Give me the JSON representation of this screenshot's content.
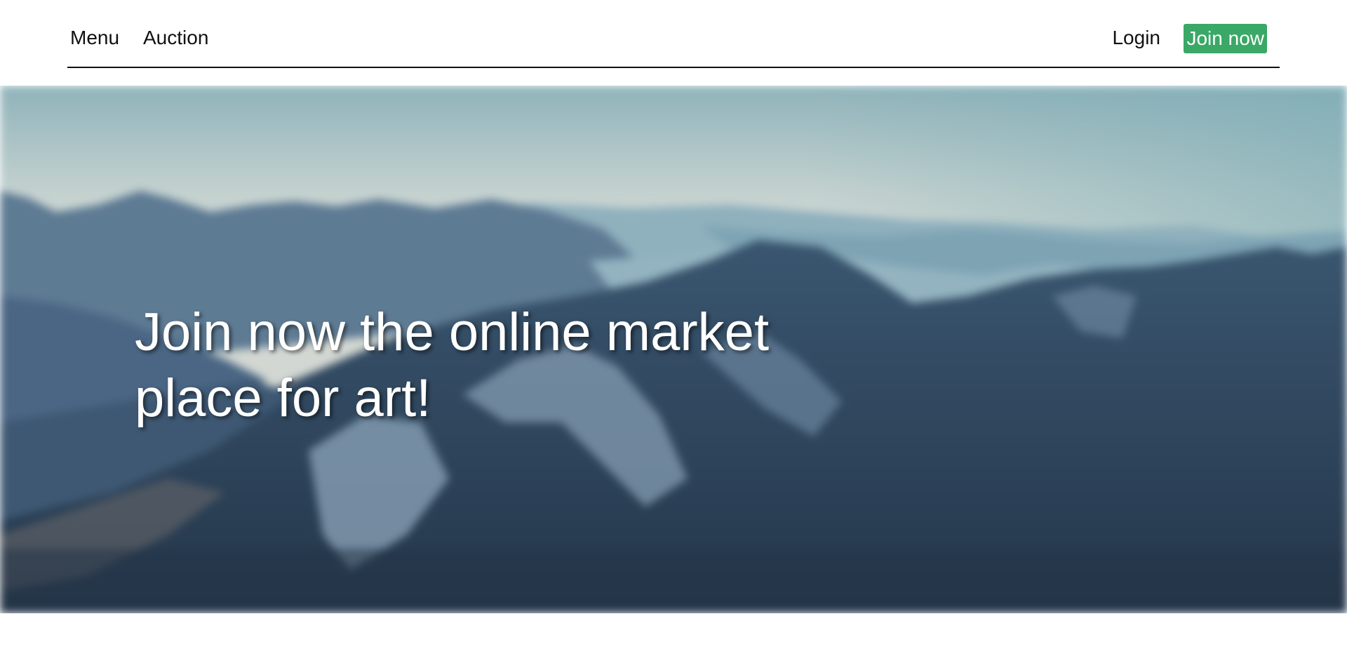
{
  "nav": {
    "menu_label": "Menu",
    "auction_label": "Auction",
    "login_label": "Login",
    "join_label": "Join now"
  },
  "hero": {
    "heading": "Join now the online market place for art!",
    "background": "blurred-mountain-landscape-image"
  },
  "colors": {
    "join_button": "#3aa866",
    "nav_text": "#111111",
    "hero_text": "#ffffff"
  }
}
